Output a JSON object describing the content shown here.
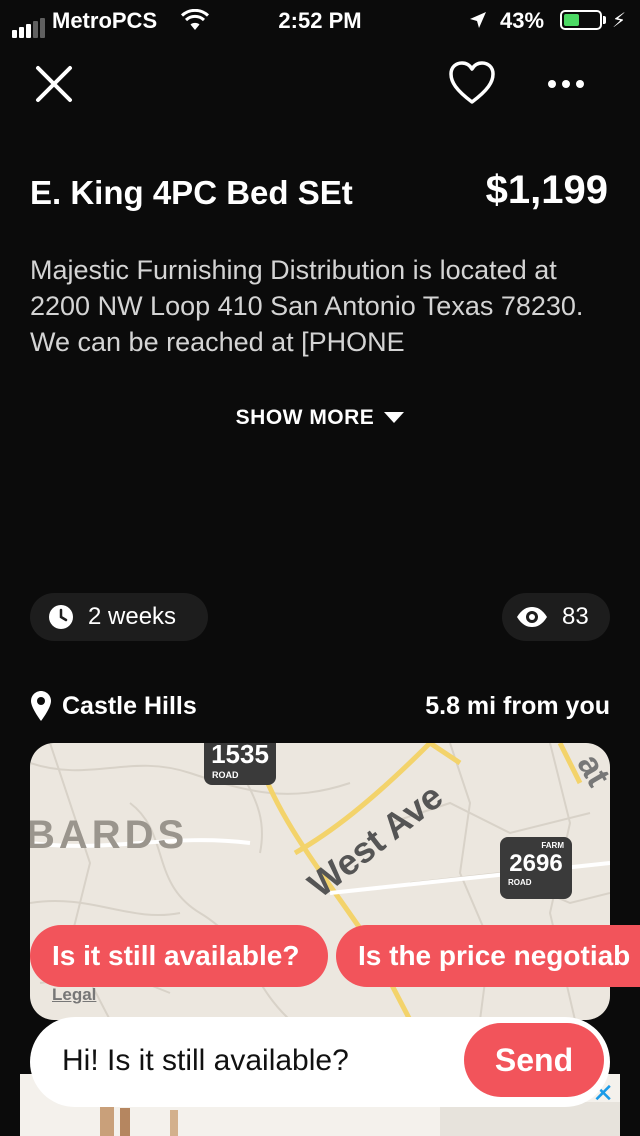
{
  "status_bar": {
    "carrier": "MetroPCS",
    "time": "2:52 PM",
    "battery_percent_text": "43%",
    "battery_level": 0.43,
    "signal_bars": 3,
    "signal_total": 5
  },
  "listing": {
    "title": "E. King 4PC Bed SEt",
    "price": "$1,199",
    "description": "Majestic Furnishing Distribution is located at 2200 NW Loop 410 San Antonio Texas 78230. We can be reached at  [PHONE",
    "show_more": "SHOW MORE",
    "posted_ago": "2 weeks",
    "views": "83",
    "location": "Castle Hills",
    "distance": "5.8 mi from you"
  },
  "map": {
    "labels": {
      "area": "BARDS",
      "street": "West Ave",
      "partial": "at"
    },
    "shields": [
      {
        "number": "1535",
        "tag": "ROAD"
      },
      {
        "number": "2696",
        "top_tag": "FARM",
        "tag": "ROAD"
      }
    ],
    "legal": "Legal"
  },
  "quick_replies": [
    "Is it still available?",
    "Is the price negotiab"
  ],
  "message": {
    "value": "Hi! Is it still available?",
    "send_label": "Send"
  },
  "colors": {
    "background": "#0b0b0b",
    "accent": "#f2545b",
    "battery": "#4cd964",
    "chip": "#1d1d1d"
  },
  "icons": {
    "close": "close-icon",
    "favorite": "heart-icon",
    "more": "more-icon",
    "time": "clock-icon",
    "views": "eye-icon",
    "location": "location-pin-icon",
    "ad_close": "close-icon"
  }
}
